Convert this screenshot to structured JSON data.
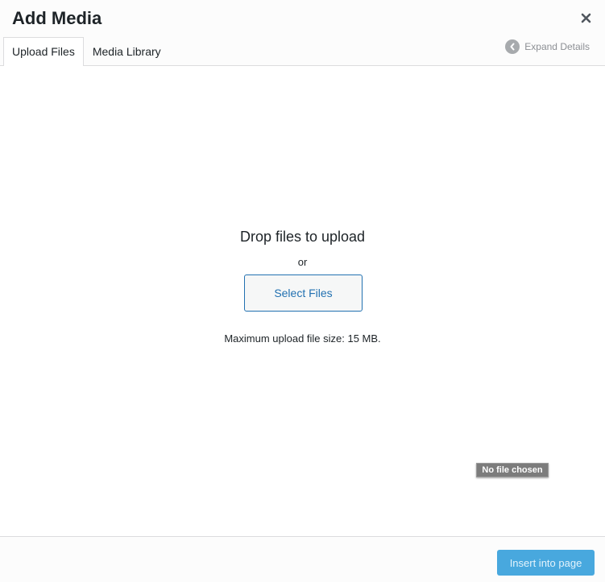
{
  "modal": {
    "title": "Add Media",
    "close_icon": "close-icon"
  },
  "header": {
    "tabs": [
      {
        "label": "Upload Files",
        "active": true
      },
      {
        "label": "Media Library",
        "active": false
      }
    ],
    "expand_details_label": "Expand Details",
    "expand_icon": "chevron-left-icon"
  },
  "uploader": {
    "drop_title": "Drop files to upload",
    "or_text": "or",
    "select_button_label": "Select Files",
    "max_size_text": "Maximum upload file size: 15 MB.",
    "file_input_status": "No file chosen"
  },
  "footer": {
    "insert_button_label": "Insert into page"
  },
  "colors": {
    "accent": "#2271b1",
    "insert_button_bg": "#48a8de",
    "header_bg": "#fcfcfc"
  }
}
